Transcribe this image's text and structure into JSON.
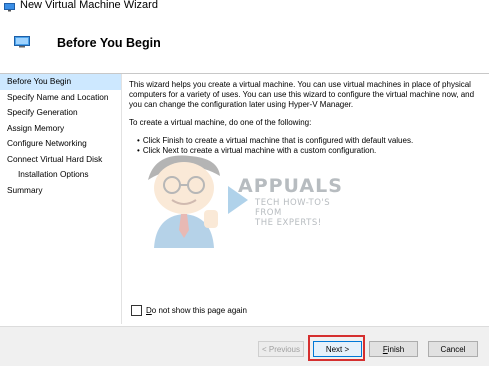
{
  "window": {
    "title": "New Virtual Machine Wizard"
  },
  "header": {
    "title": "Before You Begin"
  },
  "nav": {
    "items": [
      {
        "label": "Before You Begin",
        "active": true
      },
      {
        "label": "Specify Name and Location"
      },
      {
        "label": "Specify Generation"
      },
      {
        "label": "Assign Memory"
      },
      {
        "label": "Configure Networking"
      },
      {
        "label": "Connect Virtual Hard Disk"
      },
      {
        "label": "Installation Options"
      },
      {
        "label": "Summary"
      }
    ]
  },
  "content": {
    "intro": "This wizard helps you create a virtual machine. You can use virtual machines in place of physical computers for a variety of uses. You can use this wizard to configure the virtual machine now, and you can change the configuration later using Hyper-V Manager.",
    "instruction": "To create a virtual machine, do one of the following:",
    "bullets": [
      "Click Finish to create a virtual machine that is configured with default values.",
      "Click Next to create a virtual machine with a custom configuration."
    ]
  },
  "watermark": {
    "brand": "APPUALS",
    "tagline_1": "TECH HOW-TO'S FROM",
    "tagline_2": "THE EXPERTS!"
  },
  "checkbox": {
    "label_underlined": "D",
    "label_rest": "o not show this page again",
    "checked": false
  },
  "buttons": {
    "previous": "< Previous",
    "next": "Next >",
    "finish_underlined": "F",
    "finish_rest": "inish",
    "cancel": "Cancel"
  },
  "colors": {
    "active_nav": "#cde8ff",
    "highlight": "#d52f2f",
    "primary_button_border": "#0078d7"
  }
}
